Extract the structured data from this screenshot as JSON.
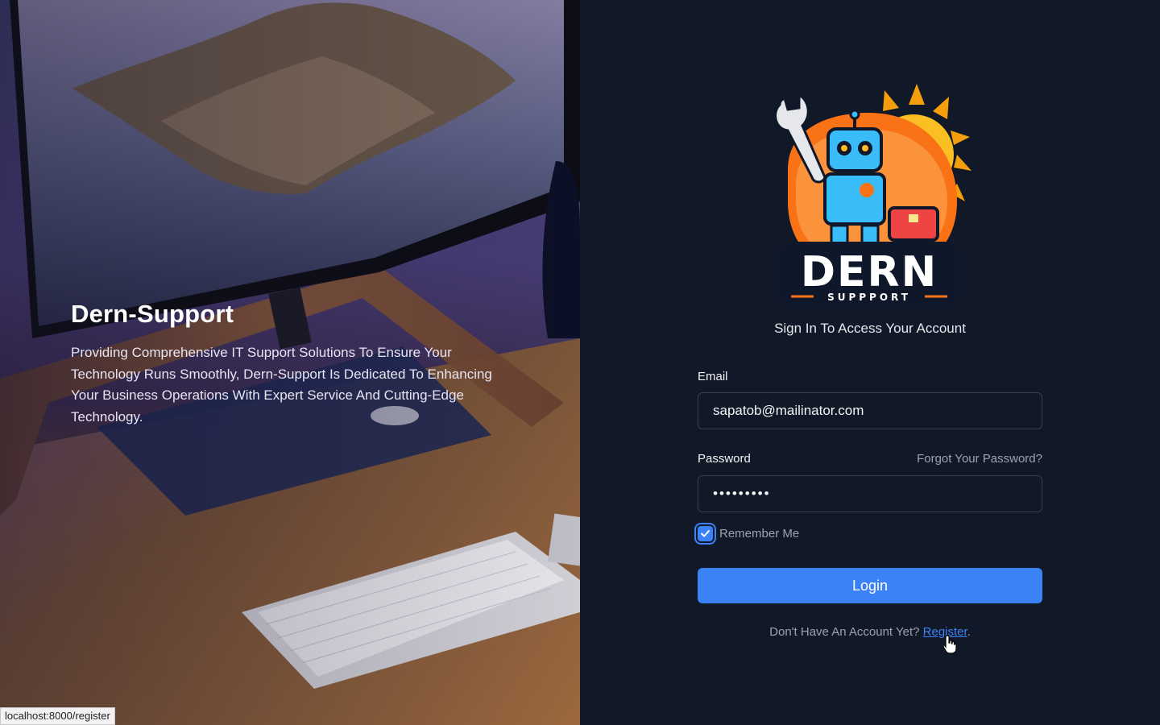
{
  "hero": {
    "title": "Dern-Support",
    "description": "Providing Comprehensive IT Support Solutions To Ensure Your Technology Runs Smoothly, Dern-Support Is Dedicated To Enhancing Your Business Operations With Expert Service And Cutting-Edge Technology."
  },
  "logo": {
    "word": "DERN",
    "tagline": "SUPPPORT"
  },
  "form": {
    "subtitle": "Sign In To Access Your Account",
    "email_label": "Email",
    "email_value": "sapatob@mailinator.com",
    "password_label": "Password",
    "password_value": "•••••••••",
    "forgot_link": "Forgot Your Password?",
    "remember_label": "Remember Me",
    "remember_checked": true,
    "login_button": "Login",
    "register_prompt": "Don't Have An Account Yet?",
    "register_link": "Register",
    "register_suffix": "."
  },
  "status_bar": {
    "url": "localhost:8000/register"
  },
  "colors": {
    "background": "#111827",
    "accent": "#3b82f6"
  }
}
